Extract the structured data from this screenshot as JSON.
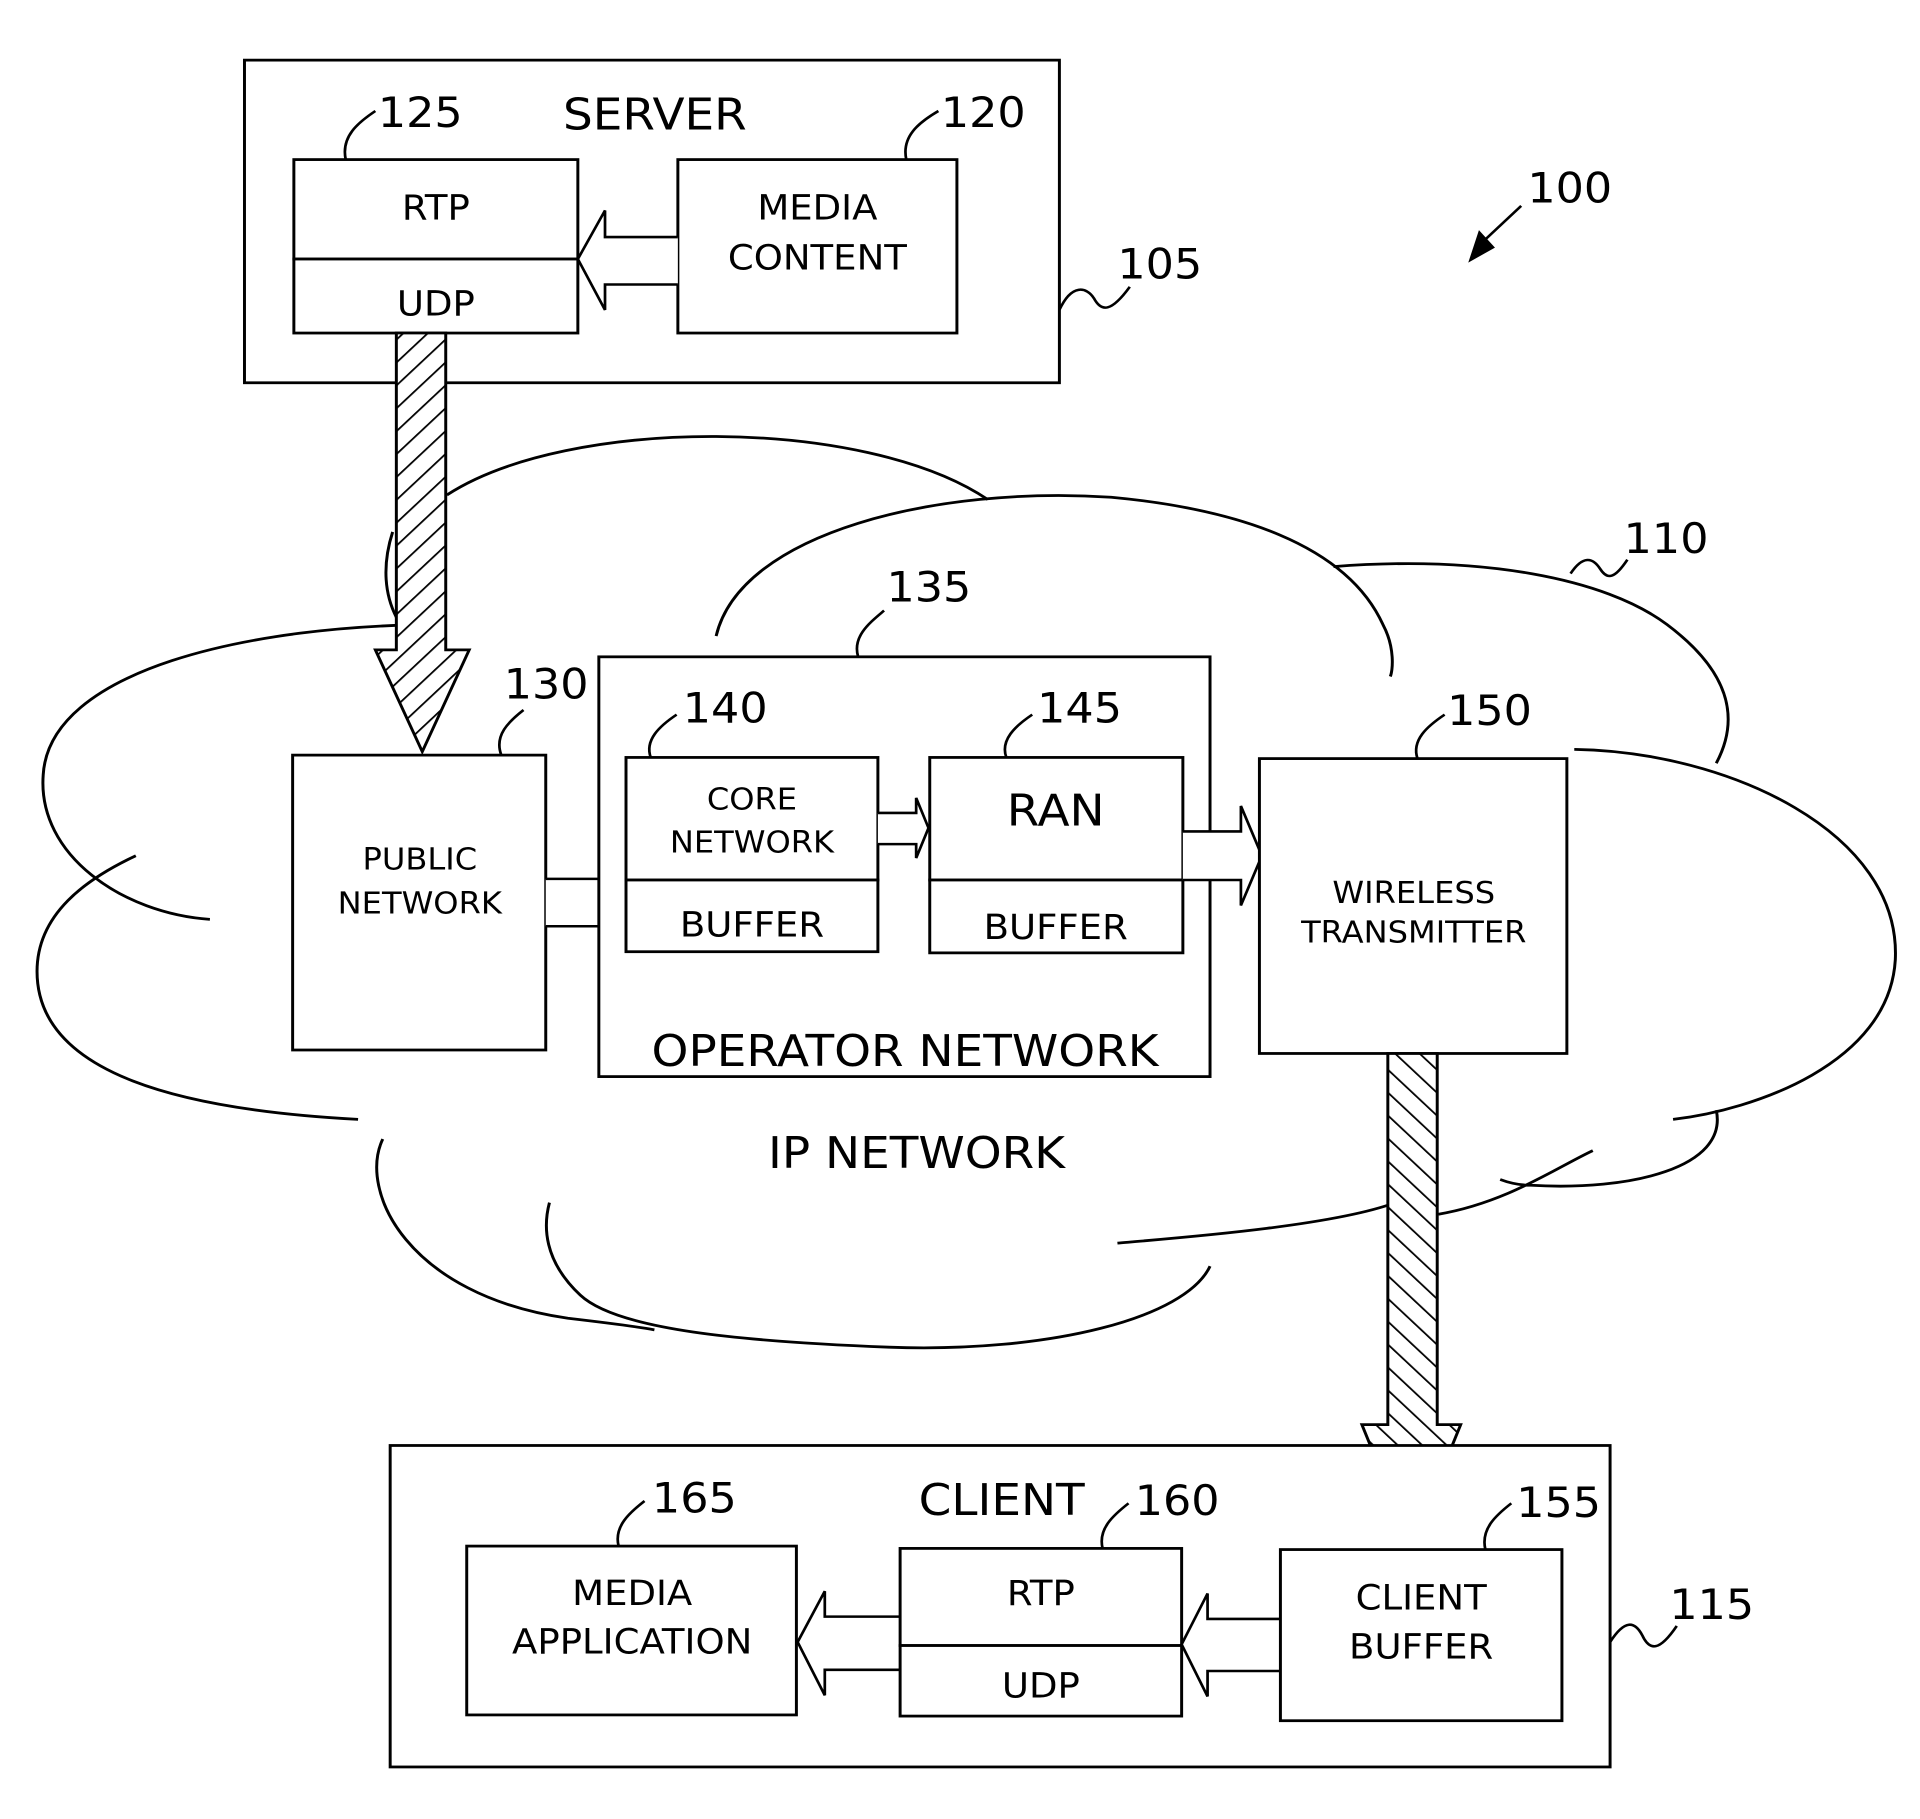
{
  "figure": {
    "ref": "100",
    "server": {
      "ref": "105",
      "title": "SERVER",
      "protocol_stack": {
        "ref": "125",
        "top": "RTP",
        "bottom": "UDP"
      },
      "media_content": {
        "ref": "120",
        "lines": [
          "MEDIA",
          "CONTENT"
        ]
      }
    },
    "ip_network": {
      "ref": "110",
      "title": "IP NETWORK",
      "public_network": {
        "ref": "130",
        "lines": [
          "PUBLIC",
          "NETWORK"
        ]
      },
      "operator_network": {
        "ref": "135",
        "title": "OPERATOR NETWORK",
        "core_network": {
          "ref": "140",
          "lines": [
            "CORE",
            "NETWORK"
          ],
          "buffer": "BUFFER"
        },
        "ran": {
          "ref": "145",
          "label": "RAN",
          "buffer": "BUFFER"
        }
      },
      "wireless_transmitter": {
        "ref": "150",
        "lines": [
          "WIRELESS",
          "TRANSMITTER"
        ]
      }
    },
    "client": {
      "ref": "115",
      "title": "CLIENT",
      "client_buffer": {
        "ref": "155",
        "lines": [
          "CLIENT",
          "BUFFER"
        ]
      },
      "protocol_stack": {
        "ref": "160",
        "top": "RTP",
        "bottom": "UDP"
      },
      "media_application": {
        "ref": "165",
        "lines": [
          "MEDIA",
          "APPLICATION"
        ]
      }
    }
  }
}
